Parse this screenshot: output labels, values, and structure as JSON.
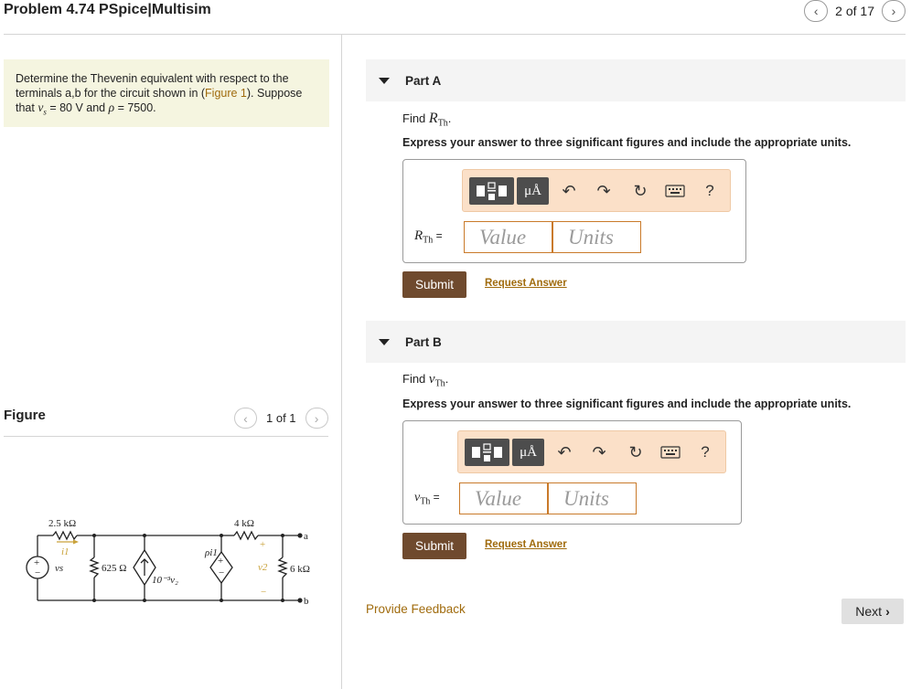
{
  "header": {
    "title": "Problem 4.74 PSpice|Multisim",
    "pager_text": "2 of 17"
  },
  "problem": {
    "text_1": "Determine the Thevenin equivalent with respect to the terminals a,b for the circuit shown in (",
    "figure_link": "Figure 1",
    "text_2": "). Suppose that ",
    "vs_symbol": "vs",
    "text_3": " = 80  V and ",
    "rho_symbol": "ρ",
    "text_4": " = 7500."
  },
  "figure": {
    "label": "Figure",
    "pager_text": "1 of 1",
    "circuit": {
      "r1": "2.5 kΩ",
      "i1": "i1",
      "vs": "vs",
      "r2": "625 Ω",
      "cs": "10⁻³v₂",
      "r3": "4 kΩ",
      "dep_v": "ρi1",
      "v2": "v2",
      "r4": "6 kΩ",
      "terminal_a": "a",
      "terminal_b": "b"
    }
  },
  "parts": [
    {
      "label": "Part A",
      "find_prefix": "Find ",
      "find_symbol": "R",
      "find_sub": "Th",
      "find_suffix": ".",
      "instructions": "Express your answer to three significant figures and include the appropriate units.",
      "answer_label_symbol": "R",
      "answer_label_sub": "Th",
      "answer_label_eq": " =",
      "value_placeholder": "Value",
      "units_placeholder": "Units",
      "submit_label": "Submit",
      "request_label": "Request Answer"
    },
    {
      "label": "Part B",
      "find_prefix": "Find ",
      "find_symbol": "v",
      "find_sub": "Th",
      "find_suffix": ".",
      "instructions": "Express your answer to three significant figures and include the appropriate units.",
      "answer_label_symbol": "v",
      "answer_label_sub": "Th",
      "answer_label_eq": " =",
      "value_placeholder": "Value",
      "units_placeholder": "Units",
      "submit_label": "Submit",
      "request_label": "Request Answer"
    }
  ],
  "toolbar": {
    "mu_label": "μÅ",
    "help_label": "?",
    "icons": [
      "templates-icon",
      "units-icon",
      "undo-icon",
      "redo-icon",
      "reset-icon",
      "keyboard-icon",
      "help-icon"
    ]
  },
  "footer": {
    "feedback_label": "Provide Feedback",
    "next_label": "Next"
  },
  "colors": {
    "accent_link": "#a06b0d",
    "submit_bg": "#6f4a2e",
    "toolbar_bg": "#fbe0c8",
    "problem_bg": "#f5f5e0"
  }
}
